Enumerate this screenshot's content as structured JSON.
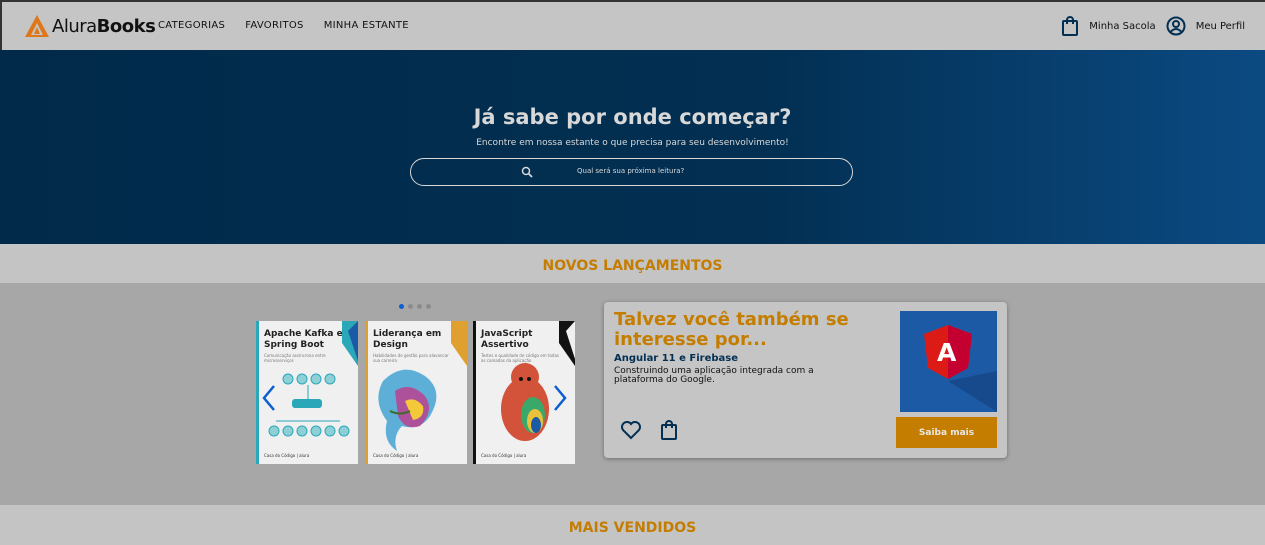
{
  "header": {
    "logo_regular": "Alura",
    "logo_bold": "Books",
    "nav": [
      "CATEGORIAS",
      "FAVORITOS",
      "MINHA ESTANTE"
    ],
    "bag_label": "Minha Sacola",
    "profile_label": "Meu Perfil"
  },
  "banner": {
    "title": "Já sabe por onde começar?",
    "subtitle": "Encontre em nossa estante o que precisa para seu desenvolvimento!",
    "search_placeholder": "Qual será sua próxima leitura?"
  },
  "novos": {
    "title": "NOVOS LANÇAMENTOS",
    "carousel_dots": 4,
    "active_dot": 0,
    "books": [
      {
        "title": "Apache Kafka e Spring Boot",
        "subtitle": "Comunicação assíncrona entre microsserviços",
        "footer": "Casa do Código | alura",
        "accent": "#2aa7b8"
      },
      {
        "title": "Liderança em Design",
        "subtitle": "Habilidades de gestão para alavancar sua carreira",
        "footer": "Casa do Código | alura",
        "accent": "#e0a030"
      },
      {
        "title": "JavaScript Assertivo",
        "subtitle": "Testes e qualidade de código em todas as camadas da aplicação",
        "footer": "Casa do Código | alura",
        "accent": "#111111"
      }
    ]
  },
  "card": {
    "title": "Talvez você também se interesse por...",
    "book_title": "Angular 11 e Firebase",
    "description": "Construindo uma aplicação integrada com a plataforma do Google.",
    "button_label": "Saiba mais",
    "image_letter": "A"
  },
  "mais": {
    "title": "MAIS VENDIDOS"
  }
}
